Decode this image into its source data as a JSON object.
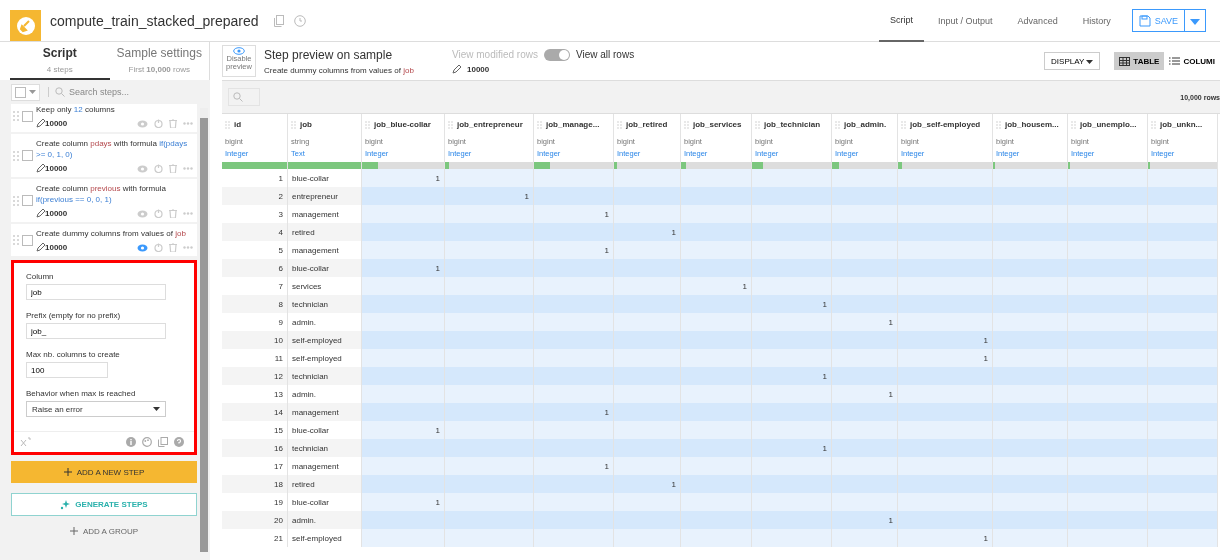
{
  "header": {
    "title": "compute_train_stacked_prepared",
    "tabs": [
      {
        "label": "Script",
        "selected": true
      },
      {
        "label": "Input / Output",
        "selected": false
      },
      {
        "label": "Advanced",
        "selected": false
      },
      {
        "label": "History",
        "selected": false
      }
    ],
    "save": "SAVE"
  },
  "sidebar": {
    "tabs": [
      {
        "label": "Script",
        "sub": "4 steps",
        "selected": true
      },
      {
        "label": "Sample settings",
        "sub": "First **10,000** rows",
        "selected": false
      }
    ],
    "select_all": {
      "checked": false
    },
    "search_placeholder": "Search steps...",
    "steps": [
      {
        "parts": [
          {
            "kind": "plain",
            "text": "Keep only "
          },
          {
            "kind": "formula",
            "text": "12"
          },
          {
            "kind": "plain",
            "text": " columns"
          }
        ],
        "count": "10000",
        "checked": false,
        "selected": false
      },
      {
        "parts": [
          {
            "kind": "plain",
            "text": "Create column "
          },
          {
            "kind": "column",
            "text": "pdays"
          },
          {
            "kind": "plain",
            "text": " with formula "
          },
          {
            "kind": "formula",
            "text": "if(pdays >= 0, 1, 0)"
          }
        ],
        "count": "10000",
        "checked": false,
        "selected": false
      },
      {
        "parts": [
          {
            "kind": "plain",
            "text": "Create column "
          },
          {
            "kind": "column",
            "text": "previous"
          },
          {
            "kind": "plain",
            "text": " with formula "
          },
          {
            "kind": "formula",
            "text": "if(previous == 0, 0, 1)"
          }
        ],
        "count": "10000",
        "checked": false,
        "selected": false
      },
      {
        "parts": [
          {
            "kind": "plain",
            "text": "Create dummy columns from values of "
          },
          {
            "kind": "column",
            "text": "job"
          }
        ],
        "count": "10000",
        "checked": false,
        "selected": true
      }
    ],
    "editor": {
      "fields": [
        {
          "label": "Column",
          "value": "job",
          "kind": "text"
        },
        {
          "label": "Prefix (empty for no prefix)",
          "value": "job_",
          "kind": "text"
        },
        {
          "label": "Max nb. columns to create",
          "value": "100",
          "kind": "short"
        },
        {
          "label": "Behavior when max is reached",
          "value": "Raise an error",
          "kind": "select"
        }
      ]
    },
    "add_step": "ADD A NEW STEP",
    "generate": "GENERATE STEPS",
    "add_group": "ADD A GROUP"
  },
  "preview": {
    "disable_label": "Disable preview",
    "title": "Step preview on sample",
    "subtitle": [
      {
        "kind": "plain",
        "text": "Create dummy columns from values of "
      },
      {
        "kind": "column",
        "text": "job"
      }
    ],
    "count": "10000",
    "modified_label": "View modified rows",
    "all_rows": {
      "label": "View all rows",
      "on": true
    },
    "display": "DISPLAY",
    "views": [
      {
        "label": "TABLE",
        "selected": true
      },
      {
        "label": "COLUMI",
        "selected": false
      }
    ],
    "row_count": "10,000 rows"
  },
  "table": {
    "columns": [
      {
        "name": "id",
        "storage": "bigint",
        "meaning": "Integer",
        "level": 1
      },
      {
        "name": "job",
        "storage": "string",
        "meaning": "Text",
        "level": 1
      },
      {
        "name": "job_blue-collar",
        "storage": "bigint",
        "meaning": "Integer",
        "level": 0.2
      },
      {
        "name": "job_entrepreneur",
        "storage": "bigint",
        "meaning": "Integer",
        "level": 0.05
      },
      {
        "name": "job_manage...",
        "storage": "bigint",
        "meaning": "Integer",
        "level": 0.2
      },
      {
        "name": "job_retired",
        "storage": "bigint",
        "meaning": "Integer",
        "level": 0.05
      },
      {
        "name": "job_services",
        "storage": "bigint",
        "meaning": "Integer",
        "level": 0.07
      },
      {
        "name": "job_technician",
        "storage": "bigint",
        "meaning": "Integer",
        "level": 0.14
      },
      {
        "name": "job_admin.",
        "storage": "bigint",
        "meaning": "Integer",
        "level": 0.1
      },
      {
        "name": "job_self-employed",
        "storage": "bigint",
        "meaning": "Integer",
        "level": 0.04
      },
      {
        "name": "job_housem...",
        "storage": "bigint",
        "meaning": "Integer",
        "level": 0.03
      },
      {
        "name": "job_unemplo...",
        "storage": "bigint",
        "meaning": "Integer",
        "level": 0.03
      },
      {
        "name": "job_unkn...",
        "storage": "bigint",
        "meaning": "Integer",
        "level": 0.03
      }
    ],
    "rows": [
      {
        "cells": [
          "1",
          "blue-collar",
          "1",
          null,
          null,
          null,
          null,
          null,
          null,
          null,
          null,
          null,
          null
        ]
      },
      {
        "cells": [
          "2",
          "entrepreneur",
          null,
          "1",
          null,
          null,
          null,
          null,
          null,
          null,
          null,
          null,
          null
        ]
      },
      {
        "cells": [
          "3",
          "management",
          null,
          null,
          "1",
          null,
          null,
          null,
          null,
          null,
          null,
          null,
          null
        ]
      },
      {
        "cells": [
          "4",
          "retired",
          null,
          null,
          null,
          "1",
          null,
          null,
          null,
          null,
          null,
          null,
          null
        ]
      },
      {
        "cells": [
          "5",
          "management",
          null,
          null,
          "1",
          null,
          null,
          null,
          null,
          null,
          null,
          null,
          null
        ]
      },
      {
        "cells": [
          "6",
          "blue-collar",
          "1",
          null,
          null,
          null,
          null,
          null,
          null,
          null,
          null,
          null,
          null
        ]
      },
      {
        "cells": [
          "7",
          "services",
          null,
          null,
          null,
          null,
          "1",
          null,
          null,
          null,
          null,
          null,
          null
        ]
      },
      {
        "cells": [
          "8",
          "technician",
          null,
          null,
          null,
          null,
          null,
          "1",
          null,
          null,
          null,
          null,
          null
        ]
      },
      {
        "cells": [
          "9",
          "admin.",
          null,
          null,
          null,
          null,
          null,
          null,
          "1",
          null,
          null,
          null,
          null
        ]
      },
      {
        "cells": [
          "10",
          "self-employed",
          null,
          null,
          null,
          null,
          null,
          null,
          null,
          "1",
          null,
          null,
          null
        ]
      },
      {
        "cells": [
          "11",
          "self-employed",
          null,
          null,
          null,
          null,
          null,
          null,
          null,
          "1",
          null,
          null,
          null
        ]
      },
      {
        "cells": [
          "12",
          "technician",
          null,
          null,
          null,
          null,
          null,
          "1",
          null,
          null,
          null,
          null,
          null
        ]
      },
      {
        "cells": [
          "13",
          "admin.",
          null,
          null,
          null,
          null,
          null,
          null,
          "1",
          null,
          null,
          null,
          null
        ]
      },
      {
        "cells": [
          "14",
          "management",
          null,
          null,
          "1",
          null,
          null,
          null,
          null,
          null,
          null,
          null,
          null
        ]
      },
      {
        "cells": [
          "15",
          "blue-collar",
          "1",
          null,
          null,
          null,
          null,
          null,
          null,
          null,
          null,
          null,
          null
        ]
      },
      {
        "cells": [
          "16",
          "technician",
          null,
          null,
          null,
          null,
          null,
          "1",
          null,
          null,
          null,
          null,
          null
        ]
      },
      {
        "cells": [
          "17",
          "management",
          null,
          null,
          "1",
          null,
          null,
          null,
          null,
          null,
          null,
          null,
          null
        ]
      },
      {
        "cells": [
          "18",
          "retired",
          null,
          null,
          null,
          "1",
          null,
          null,
          null,
          null,
          null,
          null,
          null
        ]
      },
      {
        "cells": [
          "19",
          "blue-collar",
          "1",
          null,
          null,
          null,
          null,
          null,
          null,
          null,
          null,
          null,
          null
        ]
      },
      {
        "cells": [
          "20",
          "admin.",
          null,
          null,
          null,
          null,
          null,
          null,
          "1",
          null,
          null,
          null,
          null
        ]
      },
      {
        "cells": [
          "21",
          "self-employed",
          null,
          null,
          null,
          null,
          null,
          null,
          null,
          "1",
          null,
          null,
          null
        ]
      }
    ]
  }
}
